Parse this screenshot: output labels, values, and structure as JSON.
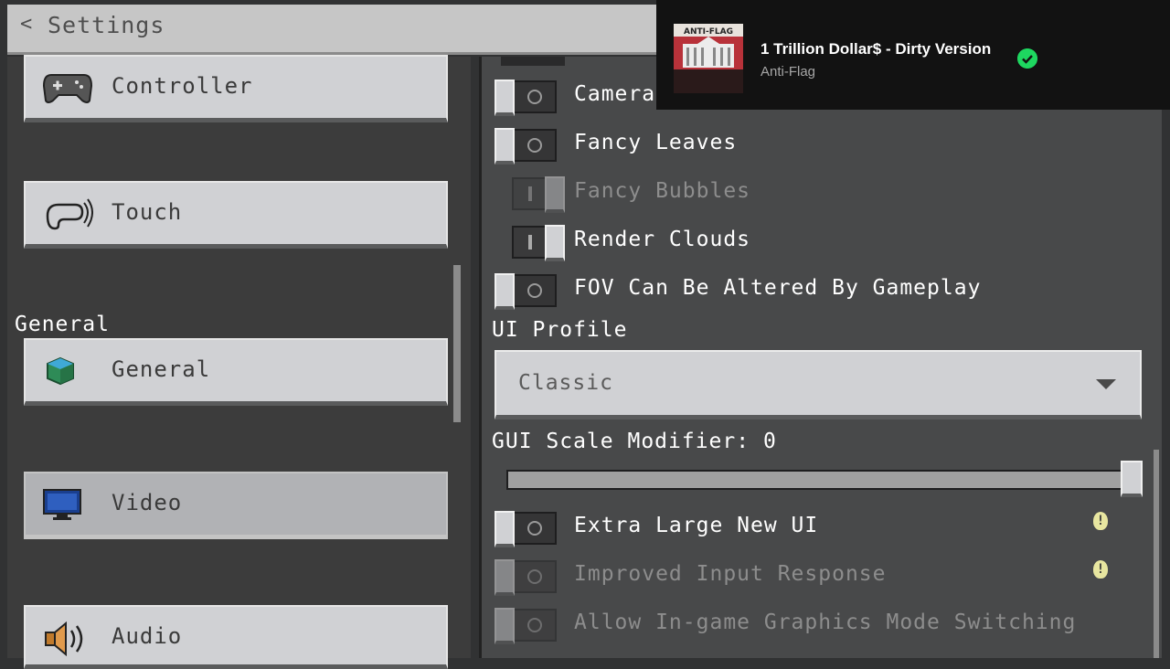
{
  "header": {
    "back_glyph": "<",
    "title": "Settings"
  },
  "sidebar": {
    "items": [
      {
        "label": "Controller",
        "icon": "gamepad-icon",
        "active": false
      },
      {
        "label": "Touch",
        "icon": "touch-hand-icon",
        "active": false
      },
      {
        "label": "General",
        "icon": "earth-block-icon",
        "active": false
      },
      {
        "label": "Video",
        "icon": "monitor-icon",
        "active": true
      },
      {
        "label": "Audio",
        "icon": "speaker-icon",
        "active": false
      }
    ],
    "section_general": "General"
  },
  "video": {
    "options": [
      {
        "label": "Camera",
        "state": "off",
        "enabled": true
      },
      {
        "label": "Fancy Leaves",
        "state": "off",
        "enabled": true
      },
      {
        "label": "Fancy Bubbles",
        "state": "on",
        "enabled": false
      },
      {
        "label": "Render Clouds",
        "state": "on",
        "enabled": true
      },
      {
        "label": "FOV Can Be Altered By Gameplay",
        "state": "off",
        "enabled": true
      }
    ],
    "ui_profile": {
      "label": "UI Profile",
      "value": "Classic"
    },
    "gui_scale": {
      "label": "GUI Scale Modifier: 0",
      "value_fraction": 1.0
    },
    "more_options": [
      {
        "label": "Extra Large New UI",
        "state": "off",
        "enabled": true,
        "info": true
      },
      {
        "label": "Improved Input Response",
        "state": "off",
        "enabled": false,
        "info": true
      },
      {
        "label": "Allow In-game Graphics Mode Switching",
        "state": "off",
        "enabled": false,
        "info": false
      }
    ]
  },
  "notification": {
    "title": "1 Trillion Dollar$ - Dirty Version",
    "artist": "Anti-Flag",
    "album_text": "ANTI-FLAG",
    "saved_icon": "check-circle-icon",
    "accent": "#1ed760"
  },
  "colors": {
    "header_bg": "#c6c6c6",
    "panel_bg": "#48494a",
    "button_bg": "#d0d1d4"
  }
}
